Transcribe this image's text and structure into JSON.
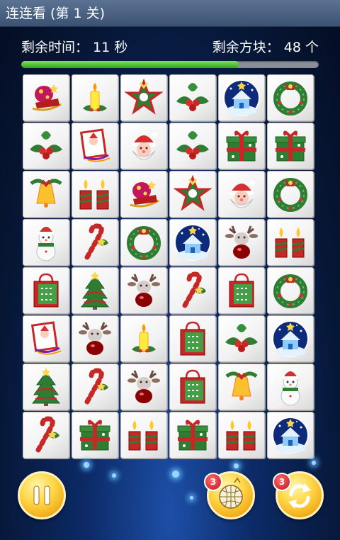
{
  "titlebar": {
    "title": "连连看 (第 1 关)"
  },
  "status": {
    "time_label": "剩余时间： 11 秒",
    "blocks_label": "剩余方块： 48 个",
    "time_progress": 0.73
  },
  "board": {
    "rows": 8,
    "cols": 6,
    "tiles": [
      [
        "sleigh",
        "candle",
        "star-wreath",
        "holly",
        "snow-house",
        "wreath"
      ],
      [
        "holly",
        "card",
        "santa",
        "holly",
        "gift",
        "gift"
      ],
      [
        "bell",
        "two-candles",
        "sleigh",
        "star-wreath",
        "santa",
        "wreath"
      ],
      [
        "snowman",
        "candy-cane",
        "wreath",
        "snow-house",
        "reindeer",
        "two-candles"
      ],
      [
        "shopping-bag",
        "tree",
        "reindeer",
        "candy-cane",
        "shopping-bag",
        "wreath"
      ],
      [
        "card",
        "reindeer",
        "candle",
        "shopping-bag",
        "holly",
        "snow-house"
      ],
      [
        "tree",
        "candy-cane",
        "reindeer",
        "shopping-bag",
        "bell",
        "snowman"
      ],
      [
        "candy-cane",
        "gift",
        "two-candles",
        "gift",
        "two-candles",
        "snow-house"
      ]
    ]
  },
  "controls": {
    "pause_icon": "pause-icon",
    "hint_icon": "disco-ball-icon",
    "hint_count": "3",
    "shuffle_icon": "refresh-icon",
    "shuffle_count": "3"
  },
  "colors": {
    "titlebar": "#4a6282",
    "progress_fill": "#2fa51e",
    "button_gold": "#f0a712",
    "badge_red": "#c1121f"
  }
}
